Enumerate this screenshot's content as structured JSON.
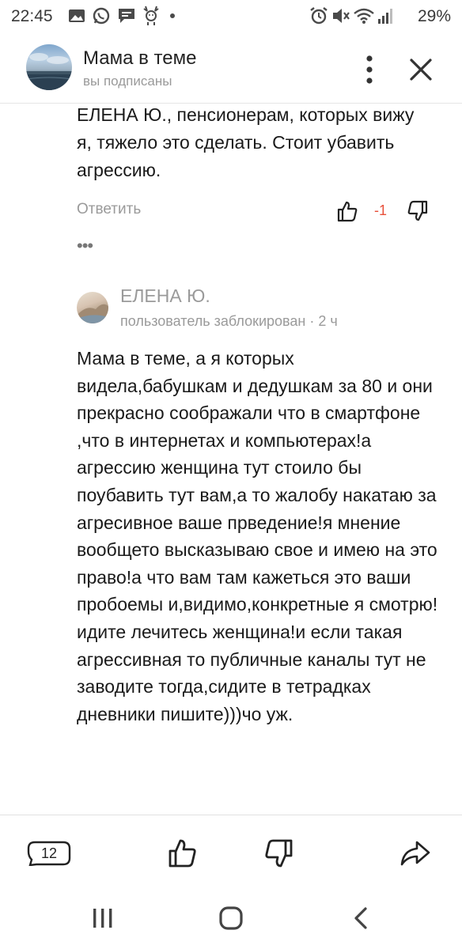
{
  "status_bar": {
    "time": "22:45",
    "battery": "29%",
    "left_icons": [
      "gallery-icon",
      "whatsapp-icon",
      "chat-icon",
      "deer-icon",
      "dot-icon"
    ],
    "right_icons": [
      "alarm-icon",
      "mute-icon",
      "wifi-icon",
      "signal-icon"
    ]
  },
  "header": {
    "title": "Мама в теме",
    "subtitle": "вы подписаны"
  },
  "comment1": {
    "text": "ЕЛЕНА Ю., пенсионерам, которых вижу я, тяжело это сделать. Стоит убавить агрессию.",
    "reply_label": "Ответить",
    "score": "-1",
    "more": "•••"
  },
  "comment2": {
    "author": "ЕЛЕНА Ю.",
    "meta": "пользователь заблокирован · 2 ч",
    "text": "Мама в теме, а я которых видела,бабушкам и дедушкам за 80 и они прекрасно соображали что в смартфоне ,что в интернетах и компьютерах!а агрессию женщина тут стоило бы поубавить тут вам,а то жалобу накатаю за агресивное ваше прведение!я мнение вообщето высказываю свое и имею на это право!а что вам там кажеться это ваши пробоемы и,видимо,конкретные я смотрю! идите лечитесь женщина!и если такая агрессивная то публичные каналы тут не заводите тогда,сидите в тетрадках дневники пишите)))чо уж."
  },
  "bottom_bar": {
    "comments_count": "12"
  },
  "colors": {
    "accent_negative": "#e8503a",
    "muted_text": "#9a9a9a"
  }
}
